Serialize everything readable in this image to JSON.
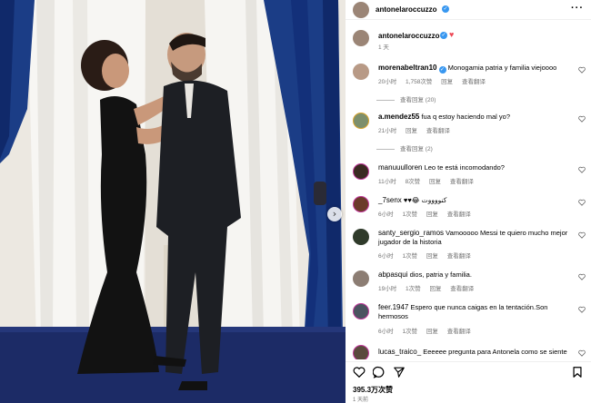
{
  "post": {
    "author": "antonelaroccuzzo",
    "more_icon": "more-horizontal-icon",
    "caption_author": "antonelaroccuzzo",
    "caption_time": "1 天",
    "caption_emoji": "❤️",
    "carousel_next": "›"
  },
  "comments": [
    {
      "user": "morenabeltran10",
      "verified": true,
      "text": "Monogamia patria y familia viejoooo",
      "time": "20小时",
      "likes": "1,758次赞",
      "reply": "回复",
      "translate": "查看翻译",
      "replies": "查看回复 (20)"
    },
    {
      "user": "a.mendez55",
      "verified": false,
      "text": "fua q estoy haciendo mal yo?",
      "time": "21小时",
      "likes": "",
      "reply": "回复",
      "translate": "查看翻译",
      "replies": "查看回复 (2)"
    },
    {
      "user": "manuuulloren",
      "verified": false,
      "text": "Leo te está incomodando?",
      "time": "11小时",
      "likes": "8次赞",
      "reply": "回复",
      "translate": "查看翻译",
      "replies": ""
    },
    {
      "user": "_7senx",
      "verified": false,
      "text": "♥♥😂 كنووووت",
      "time": "6小时",
      "likes": "1次赞",
      "reply": "回复",
      "translate": "查看翻译",
      "replies": ""
    },
    {
      "user": "santy_sergio_ramos",
      "verified": false,
      "text": "Vamooooo Messi te quiero mucho mejor jugador de la historia",
      "time": "6小时",
      "likes": "1次赞",
      "reply": "回复",
      "translate": "查看翻译",
      "replies": ""
    },
    {
      "user": "abpasqui",
      "verified": false,
      "text": "dios, patria y familia.",
      "time": "19小时",
      "likes": "1次赞",
      "reply": "回复",
      "translate": "查看翻译",
      "replies": ""
    },
    {
      "user": "feer.1947",
      "verified": false,
      "text": "Espero que nunca caigas en la tentación.Son hermosos",
      "time": "6小时",
      "likes": "1次赞",
      "reply": "回复",
      "translate": "查看翻译",
      "replies": ""
    },
    {
      "user": "lucas_traico_",
      "verified": false,
      "text": "Eeeeee pregunta para Antonela como se siente",
      "time": "",
      "likes": "",
      "reply": "",
      "translate": "",
      "replies": ""
    }
  ],
  "footer": {
    "likes": "395.3万次赞",
    "date": "1 天前",
    "icons": [
      "heart-icon",
      "comment-icon",
      "share-icon",
      "bookmark-icon"
    ]
  },
  "colors": {
    "verified": "#3897f0",
    "curtain": "#1b3d86",
    "carpet": "#1c2b66",
    "heart": "#ed4956"
  }
}
